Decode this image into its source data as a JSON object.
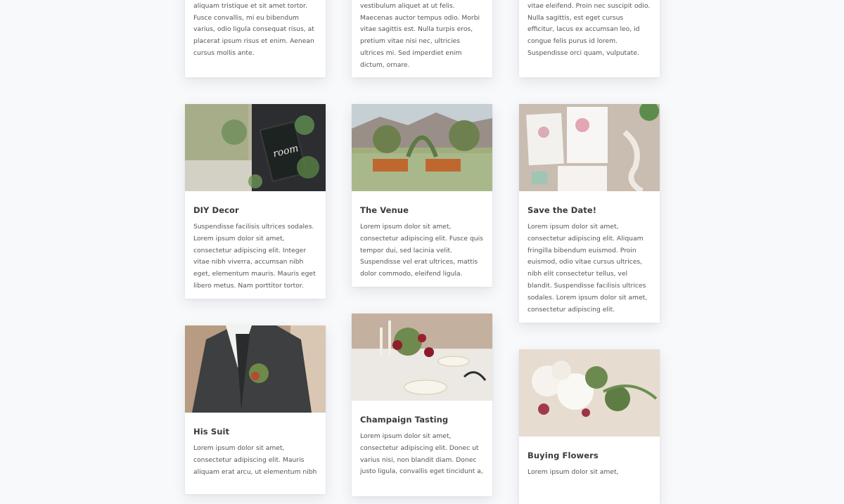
{
  "top_cards": [
    {
      "text": "laoreet eu. Pellentesque a ex at turpis aliquam tristique et sit amet tortor. Fusce convallis, mi eu bibendum varius, odio ligula consequat risus, at placerat ipsum risus et enim. Aenean cursus mollis ante."
    },
    {
      "text": "porttitor. Morbi vitae nibh et nibh vestibulum aliquet at ut felis. Maecenas auctor tempus odio. Morbi vitae sagittis est. Nulla turpis eros, pretium vitae nisi nec, ultricies ultrices mi. Sed imperdiet enim dictum, ornare."
    },
    {
      "text": "tristique ante. Nulla tempor ut ligula vitae eleifend. Proin nec suscipit odio. Nulla sagittis, est eget cursus efficitur, lacus ex accumsan leo, id congue felis purus id lorem. Suspendisse orci quam, vulputate."
    }
  ],
  "cards": [
    {
      "title": "DIY Decor",
      "text": "Suspendisse facilisis ultrices sodales. Lorem ipsum dolor sit amet, consectetur adipiscing elit. Integer vitae nibh viverra, accumsan nibh eget, elementum mauris. Mauris eget libero metus. Nam porttitor tortor.",
      "image": "chalkboard-sign-image"
    },
    {
      "title": "The Venue",
      "text": "Lorem ipsum dolor sit amet, consectetur adipiscing elit. Fusce quis tempor dui, sed lacinia velit. Suspendisse vel erat ultrices, mattis dolor commodo, eleifend ligula.",
      "image": "venue-image"
    },
    {
      "title": "Save the Date!",
      "text": "Lorem ipsum dolor sit amet, consectetur adipiscing elit. Aliquam fringilla bibendum euismod. Proin euismod, odio vitae cursus ultrices, nibh elit consectetur tellus, vel blandit. Suspendisse facilisis ultrices sodales. Lorem ipsum dolor sit amet, consectetur adipiscing elit.",
      "image": "invitation-cards-image"
    },
    {
      "title": "His Suit",
      "text": "Lorem ipsum dolor sit amet, consectetur adipiscing elit. Mauris aliquam erat arcu, ut elementum nibh",
      "image": "suit-image"
    },
    {
      "title": "Champaign Tasting",
      "text": "Lorem ipsum dolor sit amet, consectetur adipiscing elit. Donec ut varius nisi, non blandit diam. Donec justo ligula, convallis eget tincidunt a,",
      "image": "table-setting-image"
    },
    {
      "title": "Buying Flowers",
      "text": "Lorem ipsum dolor sit amet,",
      "image": "flowers-image"
    }
  ]
}
